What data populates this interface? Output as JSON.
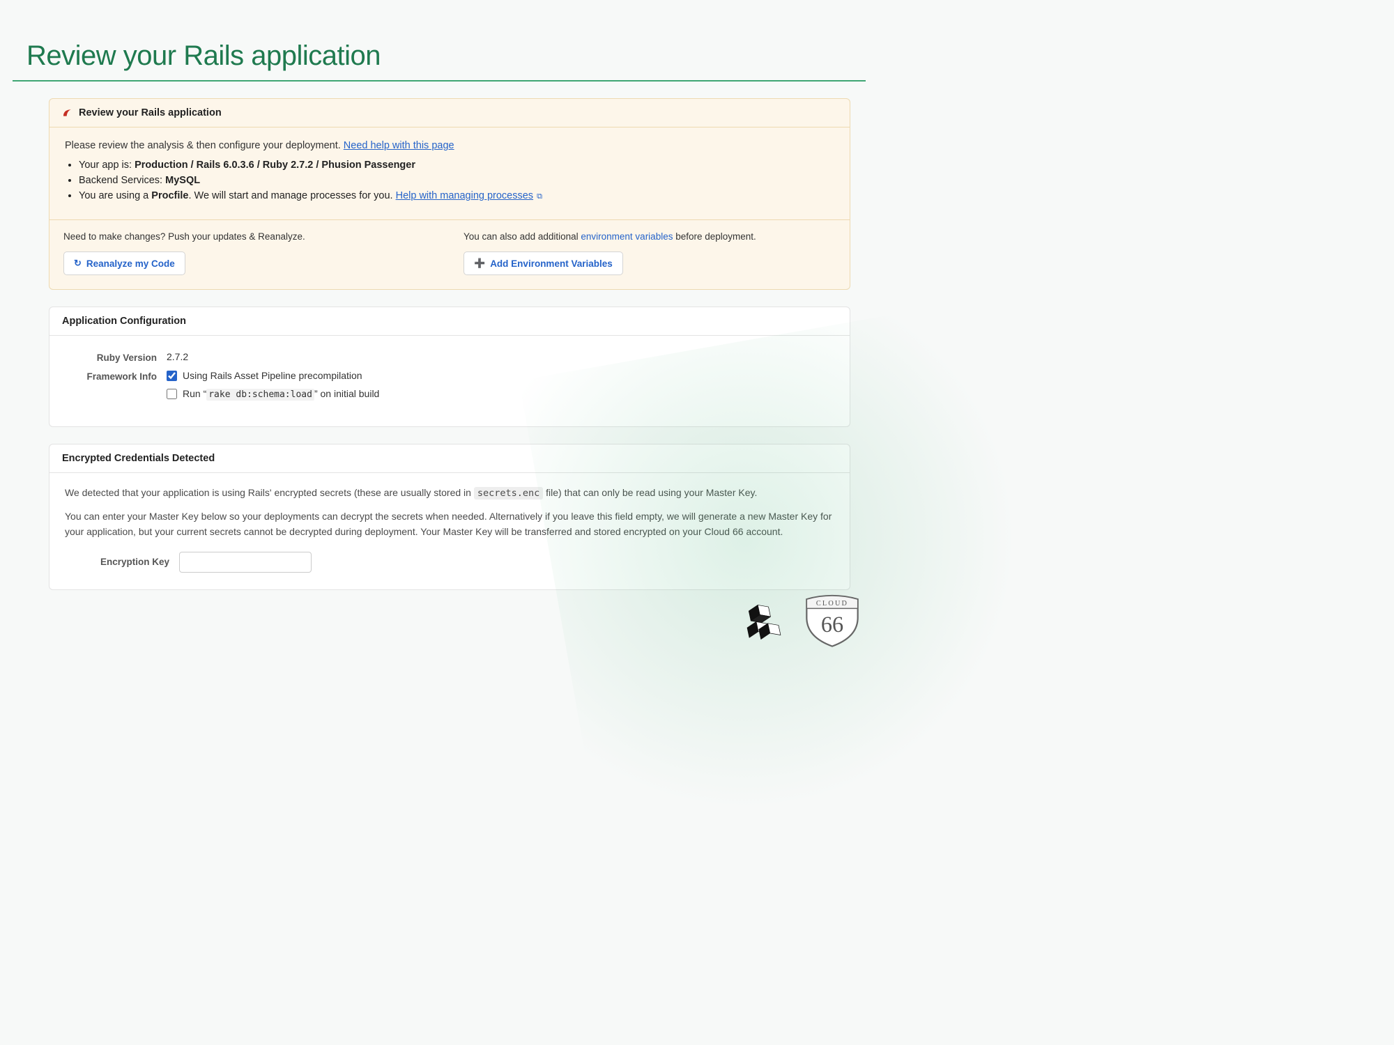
{
  "title": "Review your Rails application",
  "review": {
    "header": "Review your Rails application",
    "intro_prefix": "Please review the analysis & then configure your deployment. ",
    "intro_link": "Need help with this page",
    "bullet1": {
      "prefix": "Your app is: ",
      "bold": "Production / Rails 6.0.3.6 / Ruby 2.7.2 / Phusion Passenger"
    },
    "bullet2": {
      "prefix": "Backend Services: ",
      "bold": "MySQL"
    },
    "bullet3": {
      "prefix": "You are using a ",
      "bold": "Procfile",
      "mid": ". We will start and manage processes for you. ",
      "link": "Help with managing processes"
    },
    "actions": {
      "left_hint": "Need to make changes? Push your updates & Reanalyze.",
      "left_btn": "Reanalyze my Code",
      "right_hint_pre": "You can also add additional ",
      "right_hint_link": "environment variables",
      "right_hint_post": " before deployment.",
      "right_btn": "Add Environment Variables"
    }
  },
  "config": {
    "header": "Application Configuration",
    "ruby_label": "Ruby Version",
    "ruby_value": "2.7.2",
    "framework_label": "Framework Info",
    "cb1": {
      "checked": true,
      "text": "Using Rails Asset Pipeline precompilation"
    },
    "cb2": {
      "checked": false,
      "pre": "Run “",
      "code": "rake db:schema:load",
      "post": "” on initial build"
    }
  },
  "enc": {
    "header": "Encrypted Credentials Detected",
    "p1_pre": "We detected that your application is using Rails' encrypted secrets (these are usually stored in ",
    "p1_code": "secrets.enc",
    "p1_post": " file) that can only be read using your Master Key.",
    "p2": "You can enter your Master Key below so your deployments can decrypt the secrets when needed. Alternatively if you leave this field empty, we will generate a new Master Key for your application, but your current secrets cannot be decrypted during deployment. Your Master Key will be transferred and stored encrypted on your Cloud 66 account.",
    "key_label": "Encryption Key",
    "key_value": ""
  },
  "brand": {
    "shield_top": "CLOUD",
    "shield_num": "66"
  }
}
